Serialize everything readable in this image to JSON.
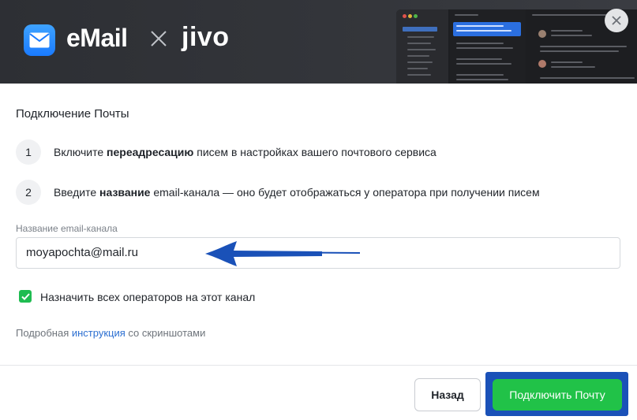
{
  "header": {
    "brand_name": "eMail",
    "partner_name": "jivo",
    "colors": {
      "background": "#2d2f34",
      "mail_icon": "#1a7bff"
    }
  },
  "close_icon": "close-icon",
  "title": "Подключение Почты",
  "steps": [
    {
      "number": "1",
      "before": "Включите ",
      "bold": "переадресацию",
      "after": " писем в настройках вашего почтового сервиса"
    },
    {
      "number": "2",
      "before": "Введите ",
      "bold": "название",
      "after": " email-канала — оно будет отображаться у оператора при получении писем"
    }
  ],
  "field": {
    "label": "Название email-канала",
    "value": "moyapochta@mail.ru"
  },
  "checkbox": {
    "checked": true,
    "label": "Назначить всех операторов на этот канал"
  },
  "help": {
    "before": "Подробная ",
    "link": "инструкция",
    "after": " со скриншотами"
  },
  "buttons": {
    "back": "Назад",
    "connect": "Подключить Почту"
  },
  "colors": {
    "primary": "#21c248",
    "link": "#2c6fd1",
    "annotation": "#1a51b8"
  }
}
